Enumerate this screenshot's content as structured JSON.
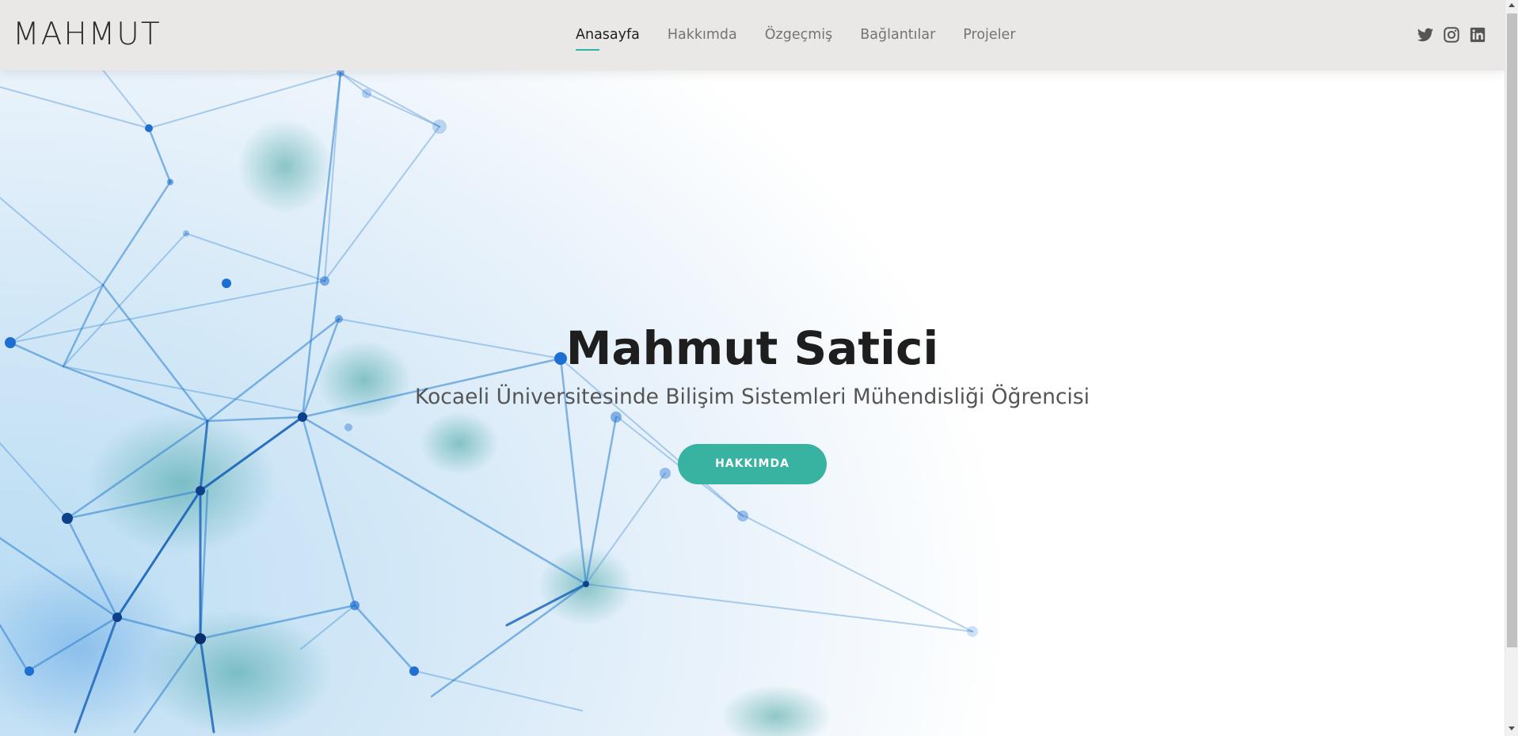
{
  "header": {
    "logo": "MAHMUT",
    "nav": [
      {
        "label": "Anasayfa",
        "active": true
      },
      {
        "label": "Hakkımda",
        "active": false
      },
      {
        "label": "Özgeçmiş",
        "active": false
      },
      {
        "label": "Bağlantılar",
        "active": false
      },
      {
        "label": "Projeler",
        "active": false
      }
    ],
    "social_icons": [
      "twitter-icon",
      "instagram-icon",
      "linkedin-icon"
    ]
  },
  "hero": {
    "title": "Mahmut Satici",
    "subtitle": "Kocaeli Üniversitesinde Bilişim Sistemleri Mühendisliği Öğrencisi",
    "button_label": "HAKKIMDA"
  },
  "colors": {
    "accent": "#38b2a1",
    "header_bg": "#e9e8e6",
    "network_line": "#2a7fd0",
    "title": "#1e1e1e",
    "subtitle": "#555555"
  }
}
